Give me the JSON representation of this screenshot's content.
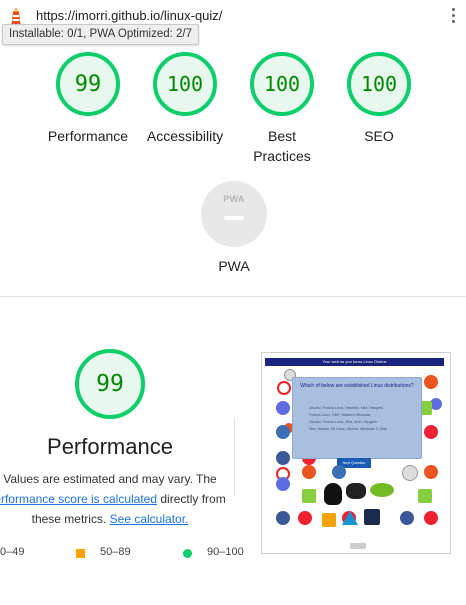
{
  "browser": {
    "url": "https://imorri.github.io/linux-quiz/",
    "tooltip": "Installable: 0/1, PWA Optimized: 2/7"
  },
  "gauges": [
    {
      "label": "Performance",
      "score": "99",
      "fraction": 0.99
    },
    {
      "label": "Accessibility",
      "score": "100",
      "fraction": 1.0
    },
    {
      "label": "Best Practices",
      "score": "100",
      "fraction": 1.0
    },
    {
      "label": "SEO",
      "score": "100",
      "fraction": 1.0
    }
  ],
  "pwa": {
    "badge": "PWA",
    "label": "PWA"
  },
  "performance": {
    "score": "99",
    "fraction": 0.99,
    "title": "Performance",
    "desc_line1": "Values are estimated and may vary. The",
    "desc_link1": "erformance score is calculated",
    "desc_mid": "directly from",
    "desc_line3": "these metrics.",
    "desc_link2": "See calculator."
  },
  "legend": {
    "fail": "0–49",
    "average": "50–89",
    "pass": "90–100"
  },
  "thumbnail": {
    "banner": "Your web as you know Linux Distros",
    "question": "Which of below are established Linux distributions?",
    "options": [
      "Ubuntu, Fedora Linux, HackMe, Mint, Hacgers",
      "Fedora Linux, ODE, Mastero Windows",
      "Ubuntu, Fedora Linux, Mint, Arch, Hacgers",
      "Mint, Hacker, Mt Linux, Ubuntu, Windows 3, Distr"
    ],
    "next_button": "Next Question"
  },
  "colors": {
    "pass": "#0cce6b",
    "pass_text": "#008800",
    "pass_bg": "#e8f8ee",
    "average": "#ffa400",
    "fail": "#ff4e42",
    "link": "#1a73e8"
  }
}
